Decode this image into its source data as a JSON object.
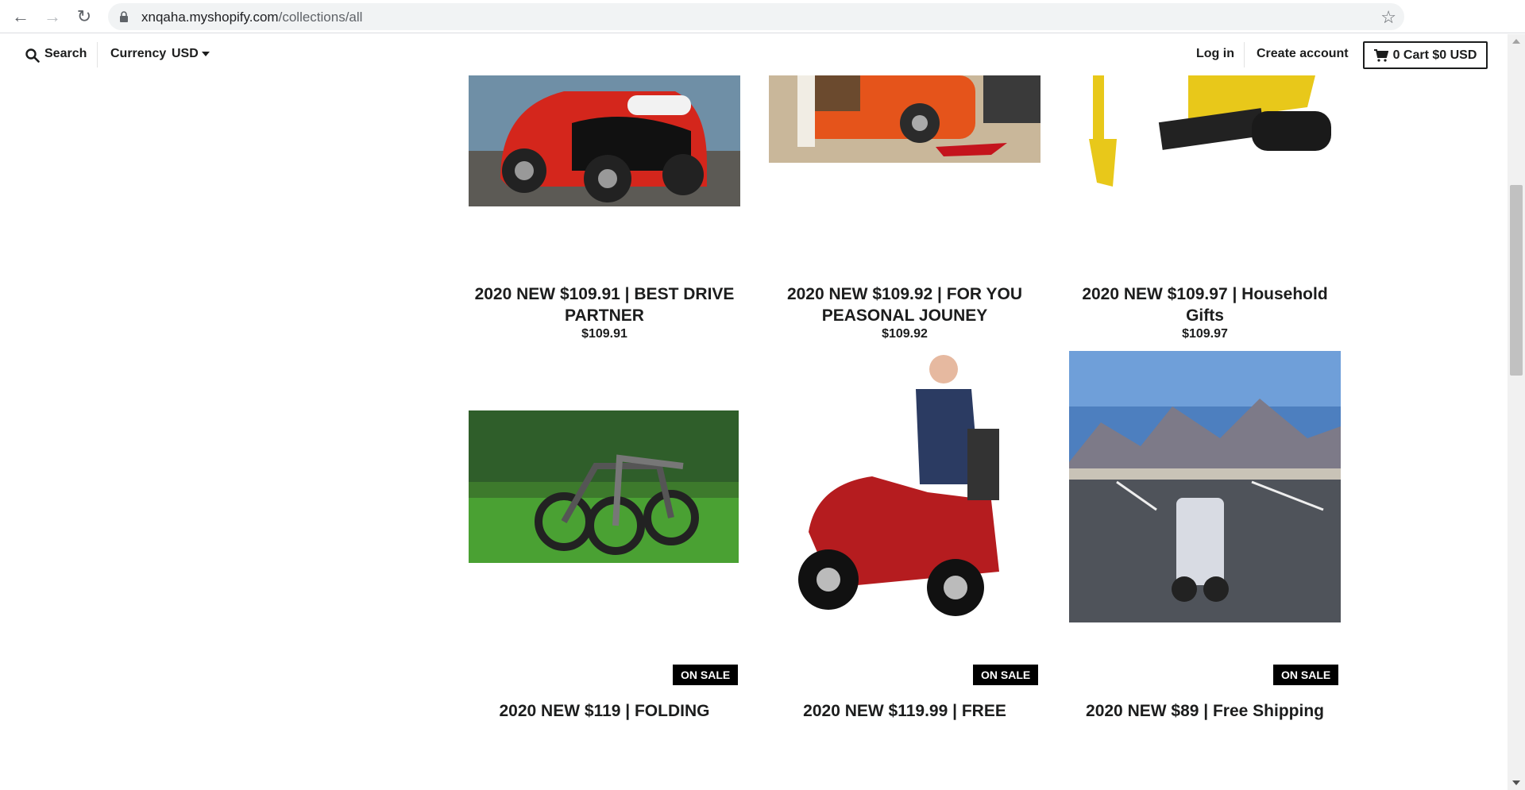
{
  "browser": {
    "url_host": "xnqaha.myshopify.com",
    "url_path": "/collections/all"
  },
  "header": {
    "search_label": "Search",
    "currency_label": "Currency",
    "currency_value": "USD",
    "login_label": "Log in",
    "create_account_label": "Create account",
    "cart_label": "0 Cart $0 USD"
  },
  "colors": {
    "text": "#1c1d1d",
    "badge_bg": "#000000",
    "badge_text": "#ffffff"
  },
  "products": [
    {
      "title_line1": "2020 NEW $109.91 | BEST DRIVE",
      "title_line2": "PARTNER",
      "price": "$109.91",
      "image": "red-electric-car-image"
    },
    {
      "title_line1": "2020 NEW $109.92 | FOR YOU",
      "title_line2": "PEASONAL JOUNEY",
      "price": "$109.92",
      "image": "orange-camper-trailer-image"
    },
    {
      "title_line1": "2020 NEW $109.97 | Household",
      "title_line2": "Gifts",
      "price": "$109.97",
      "image": "yellow-mini-excavator-image"
    },
    {
      "badge": "ON SALE",
      "title_line1": "2020 NEW $119 | FOLDING",
      "image": "folding-ebikes-on-grass-image"
    },
    {
      "badge": "ON SALE",
      "title_line1": "2020 NEW $119.99 | FREE",
      "image": "red-mobility-scooter-image"
    },
    {
      "badge": "ON SALE",
      "title_line1": "2020 NEW $89 | Free Shipping",
      "image": "folding-scooter-parking-lot-image"
    }
  ]
}
